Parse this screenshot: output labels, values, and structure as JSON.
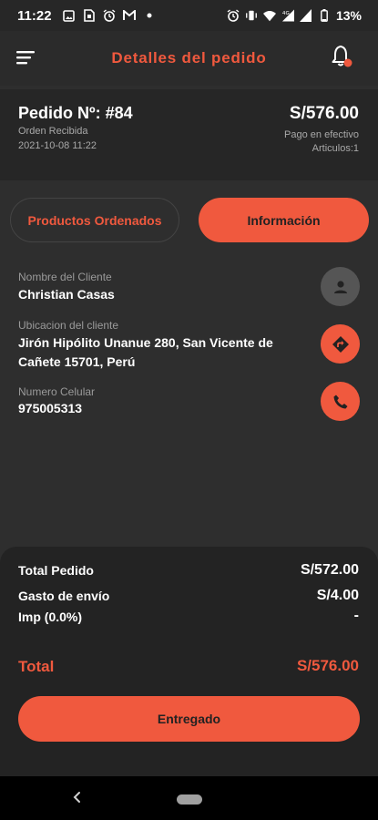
{
  "status_bar": {
    "time": "11:22",
    "battery": "13%",
    "left_icons": [
      "photo-icon",
      "sim-icon",
      "alarm-icon",
      "gmail-icon",
      "dot-icon"
    ],
    "right_icons": [
      "alarm-icon",
      "vibrate-icon",
      "wifi-icon",
      "signal-4g-icon",
      "signal-icon"
    ]
  },
  "header": {
    "title": "Detalles del pedido",
    "menu_icon": "menu-icon",
    "notification_icon": "bell-icon"
  },
  "order": {
    "number": "Pedido Nº: #84",
    "status": "Orden Recibida",
    "date": "2021-10-08 11:22",
    "total": "S/576.00",
    "payment": "Pago en efectivo",
    "items": "Articulos:1"
  },
  "tabs": {
    "products": "Productos Ordenados",
    "info": "Información",
    "active": "info"
  },
  "customer": {
    "name_label": "Nombre del Cliente",
    "name": "Christian Casas",
    "location_label": "Ubicacion del cliente",
    "location": "Jirón Hipólito Unanue 280, San Vicente de Cañete 15701, Perú",
    "phone_label": "Numero Celular",
    "phone": "975005313"
  },
  "totals": {
    "order_label": "Total Pedido",
    "order_value": "S/572.00",
    "shipping_label": "Gasto de envío",
    "shipping_value": "S/4.00",
    "tax_label": "Imp (0.0%)",
    "tax_value": "-",
    "grand_label": "Total",
    "grand_value": "S/576.00"
  },
  "action": {
    "deliver_label": "Entregado"
  },
  "colors": {
    "accent": "#f0593e",
    "background": "#2e2e2e",
    "panel": "#232323"
  }
}
